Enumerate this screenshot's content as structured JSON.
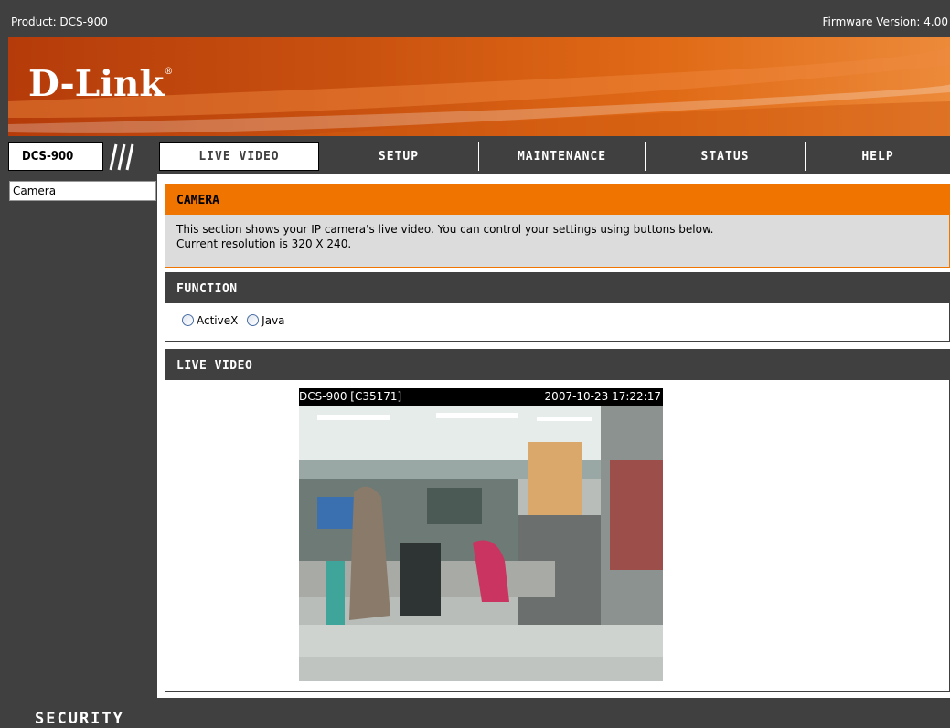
{
  "topbar": {
    "product": "Product: DCS-900",
    "firmware": "Firmware Version: 4.00"
  },
  "brand": {
    "logo_text": "D-Link",
    "logo_mark": "®",
    "accent": "#f07400",
    "dark": "#404040"
  },
  "nav": {
    "model": "DCS-900",
    "tabs": [
      {
        "label": "LIVE VIDEO",
        "active": true
      },
      {
        "label": "SETUP",
        "active": false
      },
      {
        "label": "MAINTENANCE",
        "active": false
      },
      {
        "label": "STATUS",
        "active": false
      },
      {
        "label": "HELP",
        "active": false
      }
    ]
  },
  "sidebar": {
    "items": [
      {
        "label": "Camera"
      }
    ]
  },
  "camera_section": {
    "title": "CAMERA",
    "line1": "This section shows your IP camera's live video. You can control your settings using buttons below.",
    "line2": "Current resolution is 320 X 240."
  },
  "function_section": {
    "title": "FUNCTION",
    "options": [
      {
        "label": "ActiveX",
        "checked": false
      },
      {
        "label": "Java",
        "checked": false
      }
    ]
  },
  "video_section": {
    "title": "LIVE VIDEO",
    "overlay_left": "DCS-900 [C35171]",
    "overlay_right": "2007-10-23 17:22:17"
  },
  "footer": {
    "label": "SECURITY"
  }
}
